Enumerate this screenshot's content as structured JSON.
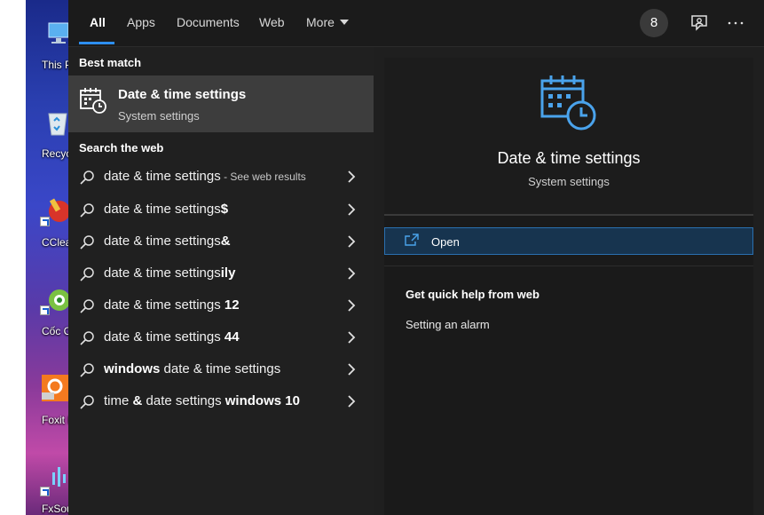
{
  "desktop": {
    "icons": [
      {
        "label": "This P"
      },
      {
        "label": "Recycle"
      },
      {
        "label": "CClean"
      },
      {
        "label": "Cốc C"
      },
      {
        "label": "Foxit Re"
      },
      {
        "label": "FxSou"
      }
    ]
  },
  "tabs": {
    "all": "All",
    "apps": "Apps",
    "documents": "Documents",
    "web": "Web",
    "more": "More"
  },
  "toolbar": {
    "badge_count": "8",
    "feedback_icon": "feedback-icon",
    "more_icon": "ellipsis-icon"
  },
  "left": {
    "best_match_heading": "Best match",
    "best_match": {
      "title": "Date & time settings",
      "subtitle": "System settings",
      "icon": "calendar-clock-icon"
    },
    "search_web_heading": "Search the web",
    "web_results": [
      {
        "prefix": "",
        "main": "date & time settings",
        "bold": "",
        "hint": " - See web results"
      },
      {
        "prefix": "",
        "main": "date & time settings",
        "bold": "$",
        "hint": ""
      },
      {
        "prefix": "",
        "main": "date & time settings",
        "bold": "&",
        "hint": ""
      },
      {
        "prefix": "",
        "main": "date & time settings",
        "bold": "ily",
        "hint": ""
      },
      {
        "prefix": "",
        "main": "date & time settings ",
        "bold": "12",
        "hint": ""
      },
      {
        "prefix": "",
        "main": "date & time settings ",
        "bold": "44",
        "hint": ""
      },
      {
        "prefix": "windows",
        "main": " date & time settings",
        "bold": "",
        "hint": ""
      },
      {
        "prefix": "",
        "main": "time ",
        "bold": "",
        "hint": "",
        "mid_bold": "&",
        "tail": " date settings ",
        "tail_bold": "windows 10"
      }
    ]
  },
  "right": {
    "title": "Date & time settings",
    "subtitle": "System settings",
    "open_label": "Open",
    "help_heading": "Get quick help from web",
    "help_links": [
      "Setting an alarm"
    ]
  },
  "colors": {
    "accent": "#2d8ef0",
    "icon_blue": "#4aa3ec",
    "open_bg": "#17344f"
  }
}
